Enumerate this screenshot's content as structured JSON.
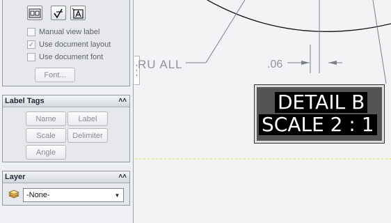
{
  "text_group": {
    "checkboxes": [
      {
        "label": "Manual view label",
        "checked": false
      },
      {
        "label": "Use document layout",
        "checked": true
      },
      {
        "label": "Use document font",
        "checked": false
      }
    ],
    "font_button": "Font..."
  },
  "label_tags": {
    "title": "Label Tags",
    "buttons": [
      "Name",
      "Label",
      "Scale",
      "Delimiter",
      "Angle"
    ]
  },
  "layer": {
    "title": "Layer",
    "selected": "-None-"
  },
  "drawing": {
    "thru_text": "RU ALL",
    "dim_text": ".06",
    "detail_line1": "DETAIL B",
    "detail_line2": "SCALE 2 : 1"
  }
}
